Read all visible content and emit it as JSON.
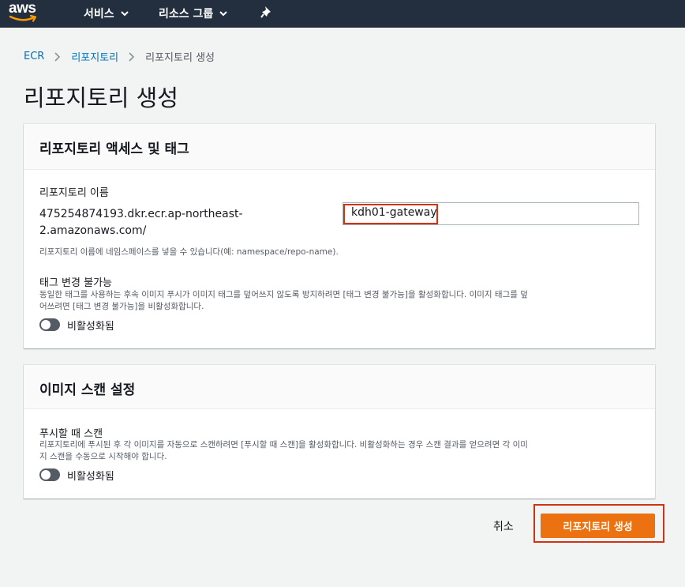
{
  "nav": {
    "logo": "aws",
    "services": "서비스",
    "resource_groups": "리소스 그룹",
    "pin_icon": "pushpin-icon"
  },
  "breadcrumb": {
    "items": [
      "ECR",
      "리포지토리",
      "리포지토리 생성"
    ]
  },
  "page": {
    "title": "리포지토리 생성"
  },
  "access_card": {
    "title": "리포지토리 액세스 및 태그",
    "repo_name_label": "리포지토리 이름",
    "repo_prefix_line1": "475254874193.dkr.ecr.ap-northeast-",
    "repo_prefix_line2": "2.amazonaws.com/",
    "repo_name_value": "kdh01-gateway",
    "repo_name_hint": "리포지토리 이름에 네임스페이스를 넣을 수 있습니다(예: namespace/repo-name).",
    "immutability_label": "태그 변경 불가능",
    "immutability_desc_line1": "동일한 태그를 사용하는 후속 이미지 푸시가 이미지 태그를 덮어쓰지 않도록 방지하려면 [태그 변경 불가능]을 활성화합니다. 이미지 태그를 덮",
    "immutability_desc_line2": "어쓰려면 [태그 변경 불가능]을 비활성화합니다.",
    "immutability_toggle_label": "비활성화됨",
    "immutability_enabled": false
  },
  "scan_card": {
    "title": "이미지 스캔 설정",
    "scan_label": "푸시할 때 스캔",
    "scan_desc_line1": "리포지토리에 푸시된 후 각 이미지를 자동으로 스캔하려면 [푸시할 때 스캔]을 활성화합니다. 비활성화하는 경우 스캔 결과를 얻으려면 각 이미",
    "scan_desc_line2": "지 스캔을 수동으로 시작해야 합니다.",
    "scan_toggle_label": "비활성화됨",
    "scan_enabled": false
  },
  "actions": {
    "cancel": "취소",
    "create": "리포지토리 생성"
  },
  "colors": {
    "nav_bg": "#232f3e",
    "primary": "#ec7211",
    "highlight": "#d13212",
    "link": "#0073bb"
  }
}
